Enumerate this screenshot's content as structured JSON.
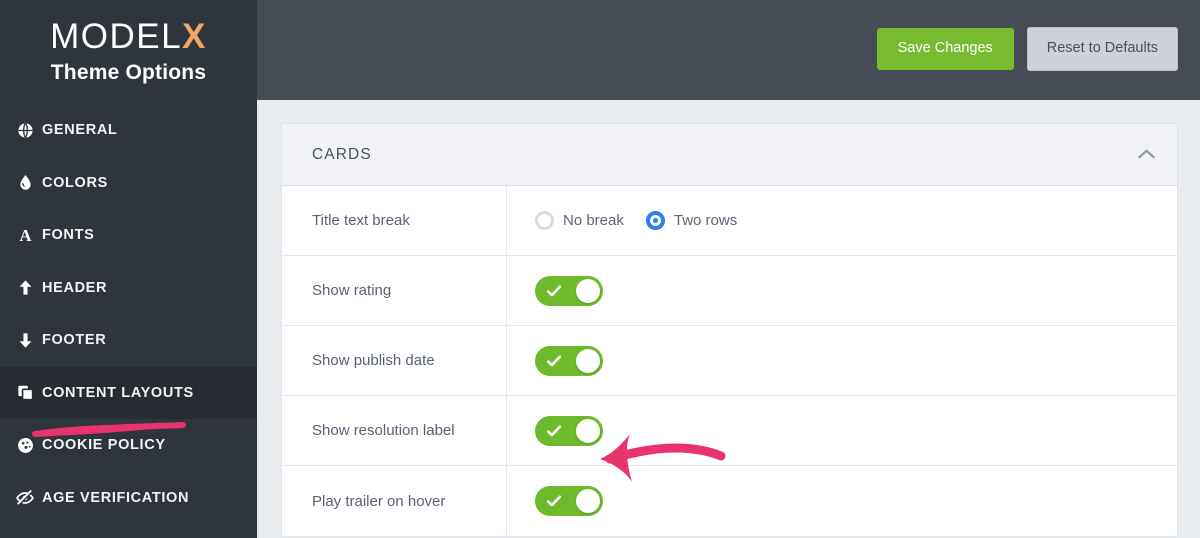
{
  "brand": {
    "logo_main": "MODEL",
    "logo_accent": "X",
    "subtitle": "Theme Options",
    "accent_color": "#f0a860"
  },
  "topbar": {
    "save_label": "Save Changes",
    "save_color": "#78bb31",
    "reset_label": "Reset to Defaults",
    "reset_color": "#ced2d8"
  },
  "sidebar": {
    "background": "#2f353d",
    "active_background": "#272c33",
    "items": [
      {
        "label": "GENERAL",
        "icon": "globe-icon",
        "active": false
      },
      {
        "label": "COLORS",
        "icon": "droplet-icon",
        "active": false
      },
      {
        "label": "FONTS",
        "icon": "font-a-icon",
        "active": false
      },
      {
        "label": "HEADER",
        "icon": "arrow-up-icon",
        "active": false
      },
      {
        "label": "FOOTER",
        "icon": "arrow-down-icon",
        "active": false
      },
      {
        "label": "CONTENT LAYOUTS",
        "icon": "layers-icon",
        "active": true
      },
      {
        "label": "COOKIE POLICY",
        "icon": "cookie-icon",
        "active": false
      },
      {
        "label": "AGE VERIFICATION",
        "icon": "eye-off-icon",
        "active": false
      }
    ]
  },
  "panel": {
    "title": "CARDS",
    "collapse_icon": "chevron-up-icon",
    "rows": [
      {
        "label": "Title text break",
        "type": "radio",
        "options": [
          {
            "label": "No break",
            "selected": false
          },
          {
            "label": "Two rows",
            "selected": true
          }
        ]
      },
      {
        "label": "Show rating",
        "type": "toggle",
        "value": "on"
      },
      {
        "label": "Show publish date",
        "type": "toggle",
        "value": "on"
      },
      {
        "label": "Show resolution label",
        "type": "toggle",
        "value": "on"
      },
      {
        "label": "Play trailer on hover",
        "type": "toggle",
        "value": "on"
      }
    ]
  },
  "annotations": {
    "color": "#e8336d",
    "underline_target": "CONTENT LAYOUTS",
    "arrow_target": "Play trailer on hover"
  }
}
